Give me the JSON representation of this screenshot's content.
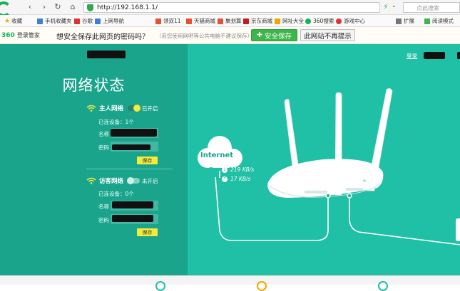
{
  "browser": {
    "back": "‹",
    "forward": "›",
    "refresh": "↻",
    "home": "⌂",
    "url": "http://192.168.1.1/",
    "search_placeholder": "点此搜索"
  },
  "favorites": [
    {
      "label": "收藏",
      "color": "#f0a800"
    },
    {
      "label": "手机收藏夹",
      "color": "#3d7edb"
    },
    {
      "label": "谷歌",
      "color": "#d33"
    },
    {
      "label": "上网导航",
      "color": "#3d7edb"
    },
    {
      "label": "领双11",
      "color": "#e8502e"
    },
    {
      "label": "天猫商城",
      "color": "#e8502e"
    },
    {
      "label": "聚划算",
      "color": "#e8502e"
    },
    {
      "label": "京东商城",
      "color": "#c81623"
    },
    {
      "label": "网址大全",
      "color": "#f0a800"
    },
    {
      "label": "360搜索",
      "color": "#18b15a"
    },
    {
      "label": "游戏中心",
      "color": "#d33"
    }
  ],
  "favbar_right": {
    "ext": "扩展",
    "read": "阅读模式"
  },
  "password_prompt": {
    "brand": "360",
    "brand_sub": "登录管家",
    "question": "想安全保存此网页的密码吗？",
    "hint": "（若您使用网吧等公共电脑不建议保存）",
    "save_label": "安全保存",
    "no_prompt_label": "此网站不再提示"
  },
  "router": {
    "title": "网络状态",
    "login_link": "登录",
    "main_network": {
      "title": "主人网络",
      "state": "已开启",
      "connected": "已连设备：1个",
      "name_label": "名称",
      "password_label": "密码",
      "save_label": "保存"
    },
    "guest_network": {
      "title": "访客网络",
      "state": "未开启",
      "connected": "已连设备：0个",
      "name_label": "名称",
      "password_label": "密码",
      "save_label": "保存"
    },
    "diagram": {
      "internet_label": "Internet",
      "download_speed": "219 KB/s",
      "upload_speed": "17 KB/s"
    }
  },
  "colors": {
    "left_panel": "#1ba48c",
    "right_panel": "#1fc0a5",
    "save_button": "#3cb54a",
    "small_save": "#f4ec3a"
  }
}
